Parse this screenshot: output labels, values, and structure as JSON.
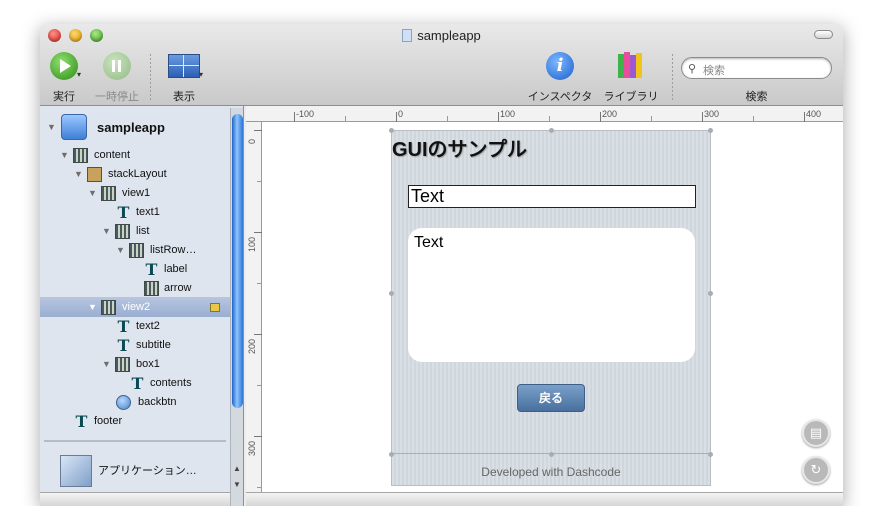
{
  "window": {
    "title": "sampleapp"
  },
  "toolbar": {
    "run_label": "実行",
    "pause_label": "一時停止",
    "view_label": "表示",
    "inspector_label": "インスペクタ",
    "library_label": "ライブラリ",
    "search_placeholder": "検索",
    "search_label": "検索"
  },
  "tree": {
    "root": "sampleapp",
    "nodes": [
      {
        "label": "content"
      },
      {
        "label": "stackLayout"
      },
      {
        "label": "view1"
      },
      {
        "label": "text1"
      },
      {
        "label": "list"
      },
      {
        "label": "listRow…"
      },
      {
        "label": "label"
      },
      {
        "label": "arrow"
      },
      {
        "label": "view2"
      },
      {
        "label": "text2"
      },
      {
        "label": "subtitle"
      },
      {
        "label": "box1"
      },
      {
        "label": "contents"
      },
      {
        "label": "backbtn"
      },
      {
        "label": "footer"
      }
    ],
    "selected": "view2"
  },
  "sidebar_bottom": {
    "app_item": "アプリケーション…"
  },
  "ruler": {
    "h_ticks": [
      "-100",
      "0",
      "100",
      "200",
      "300",
      "400"
    ],
    "v_ticks": [
      "0",
      "100",
      "200",
      "300"
    ]
  },
  "preview": {
    "title": "GUIのサンプル",
    "textfield_value": "Text",
    "textarea_value": "Text",
    "back_button": "戻る",
    "footer": "Developed with Dashcode"
  },
  "icons": {
    "run": "play-icon",
    "pause": "pause-icon",
    "view": "view-layout-icon",
    "inspector": "info-icon",
    "library": "library-books-icon",
    "search": "magnifier-icon"
  },
  "colors": {
    "accent": "#2a6fd6",
    "selection": "#a9b9d6",
    "button": "#5a80ad"
  }
}
